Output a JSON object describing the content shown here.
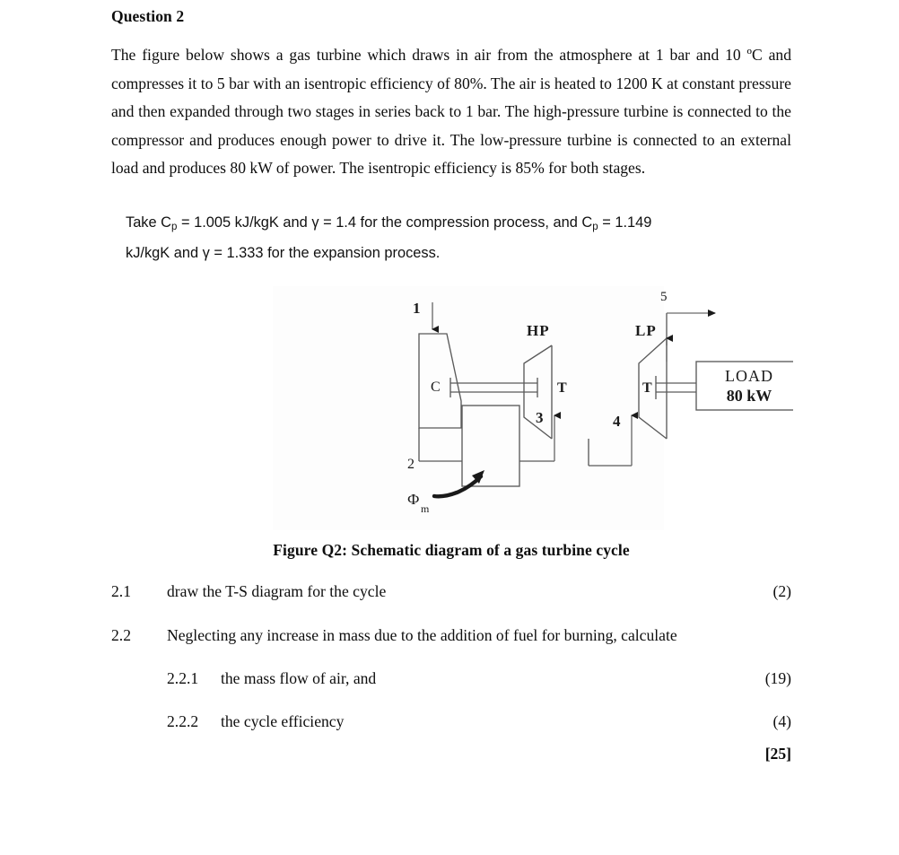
{
  "heading": "Question 2",
  "paragraph": "The figure below shows a gas turbine which draws in air from the atmosphere at 1 bar and 10 ºC and compresses it to 5 bar with an isentropic efficiency of 80%. The air is heated to 1200 K at constant pressure and then expanded through two stages in series back to 1 bar. The high-pressure turbine is connected to the compressor and produces enough power to drive it. The low-pressure turbine is connected to an external load and produces 80 kW of power. The isentropic efficiency is 85% for both stages.",
  "take_note": {
    "line1_a": "Take C",
    "line1_sub1": "p",
    "line1_b": " = 1.005 kJ/kgK and γ = 1.4 for the compression process, and C",
    "line1_sub2": "p",
    "line1_c": " = 1.149",
    "line2": "kJ/kgK and γ = 1.333 for the expansion process."
  },
  "figure": {
    "caption": "Figure Q2: Schematic diagram of a gas turbine cycle",
    "labels": {
      "inlet": "1",
      "compressor": "C",
      "compressor_outlet": "2",
      "heat_input": "Ф",
      "heat_input_sub": "m",
      "combustor_outlet": "3",
      "hp_tag": "HP",
      "hp_turbine": "T",
      "interstage": "4",
      "lp_tag": "LP",
      "lp_turbine": "T",
      "exhaust": "5",
      "load_line1": "LOAD",
      "load_line2": "80 kW"
    },
    "stroke_color": "#5a5a5a",
    "text_color": "#1a1a1a"
  },
  "questions": [
    {
      "number": "2.1",
      "level": 1,
      "text": "draw the T-S diagram for the cycle",
      "marks": "(2)",
      "bold": false
    },
    {
      "number": "2.2",
      "level": 1,
      "text": "Neglecting any increase in mass due to the addition of fuel for burning, calculate",
      "marks": "",
      "bold": false
    },
    {
      "number": "2.2.1",
      "level": 2,
      "text": "the mass flow of air, and",
      "marks": "(19)",
      "bold": false
    },
    {
      "number": "2.2.2",
      "level": 2,
      "text": "the cycle efficiency",
      "marks": "(4)",
      "bold": false
    }
  ],
  "total_marks": "[25]"
}
